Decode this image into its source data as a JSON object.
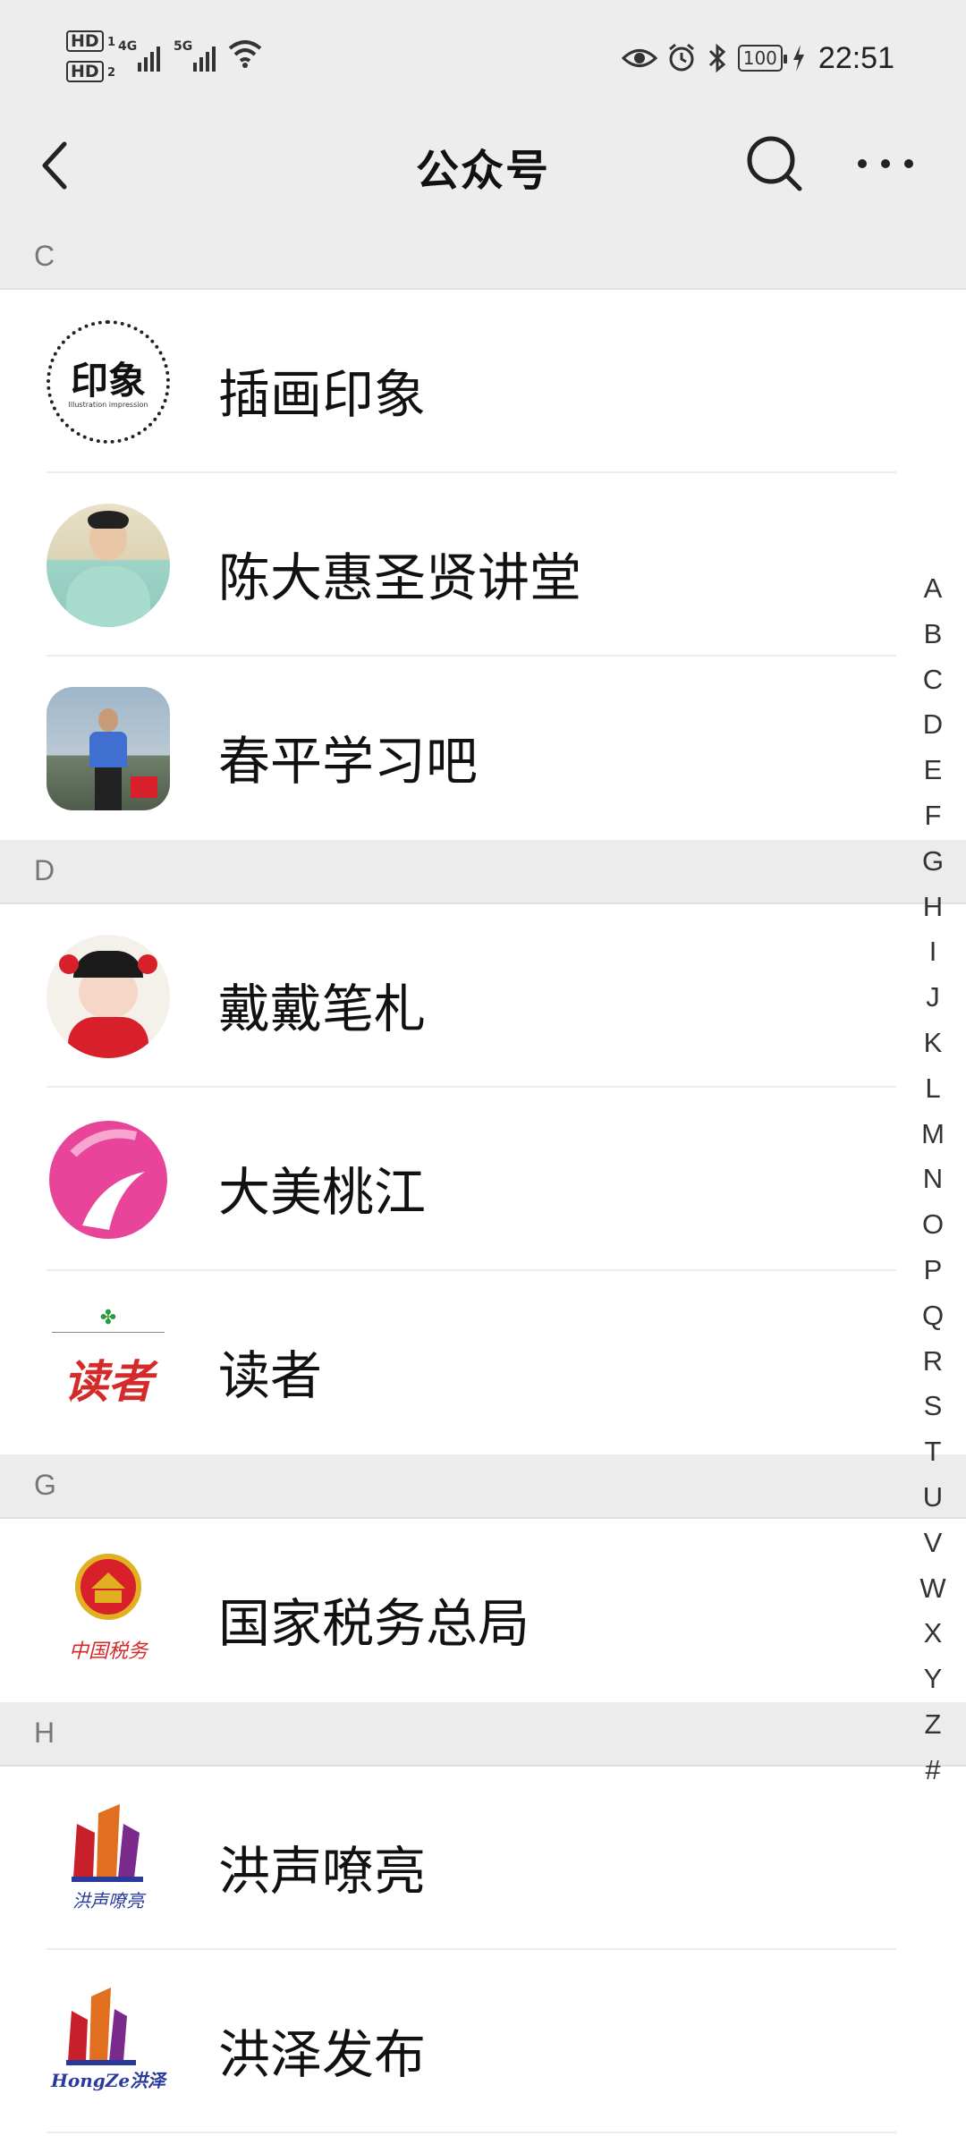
{
  "status_bar": {
    "time": "22:51",
    "battery": "100",
    "sim1": "HD",
    "sim1_sub": "1",
    "sim2": "HD",
    "sim2_sub": "2",
    "network1": "4G",
    "network2": "5G",
    "icons": [
      "eye-icon",
      "alarm-icon",
      "bluetooth-icon",
      "battery-icon",
      "charging-icon",
      "wifi-icon",
      "signal-icon"
    ]
  },
  "navbar": {
    "title": "公众号",
    "icons": [
      "back-icon",
      "search-icon",
      "more-icon"
    ]
  },
  "sections": [
    {
      "letter": "C",
      "items": [
        {
          "name": "插画印象",
          "avatar_text": "印象",
          "avatar_sub": "Illustration impression"
        },
        {
          "name": "陈大惠圣贤讲堂"
        },
        {
          "name": "春平学习吧"
        }
      ]
    },
    {
      "letter": "D",
      "items": [
        {
          "name": "戴戴笔札"
        },
        {
          "name": "大美桃江"
        },
        {
          "name": "读者",
          "avatar_text": "读者"
        }
      ]
    },
    {
      "letter": "G",
      "items": [
        {
          "name": "国家税务总局",
          "avatar_text": "中国税务"
        }
      ]
    },
    {
      "letter": "H",
      "items": [
        {
          "name": "洪声嘹亮",
          "avatar_text": "洪声嘹亮"
        },
        {
          "name": "洪泽发布",
          "avatar_text": "HongZe洪泽"
        }
      ]
    }
  ],
  "index_letters": [
    "A",
    "B",
    "C",
    "D",
    "E",
    "F",
    "G",
    "H",
    "I",
    "J",
    "K",
    "L",
    "M",
    "N",
    "O",
    "P",
    "Q",
    "R",
    "S",
    "T",
    "U",
    "V",
    "W",
    "X",
    "Y",
    "Z",
    "#"
  ],
  "colors": {
    "header_bg": "#ededed",
    "section_bg": "#ececec",
    "accent_pink": "#e8449a",
    "text_dark": "#111111"
  }
}
